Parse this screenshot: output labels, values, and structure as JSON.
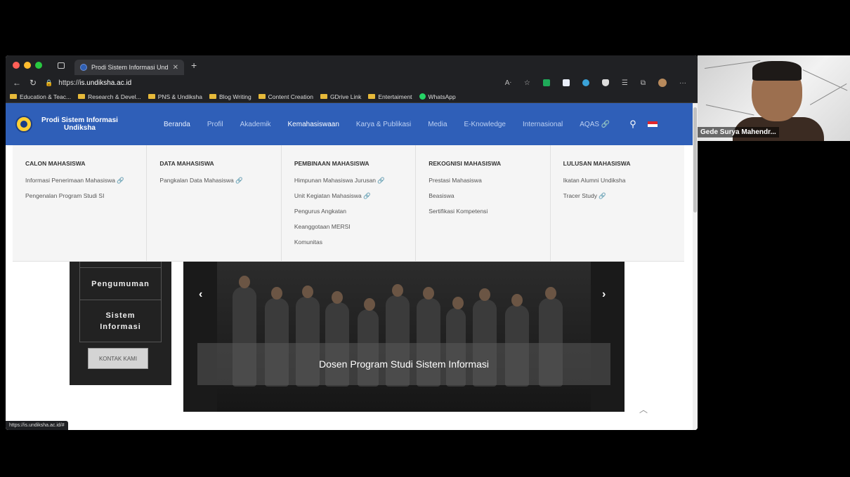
{
  "browser": {
    "tab_title": "Prodi Sistem Informasi Undiksha",
    "url_prefix": "https://",
    "url_domain": "is.undiksha.ac.id",
    "bookmarks": [
      "Education & Teac...",
      "Research & Devel...",
      "PNS & Undiksha",
      "Blog Writing",
      "Content Creation",
      "GDrive Link",
      "Entertaiment",
      "WhatsApp"
    ],
    "status_url": "https://is.undiksha.ac.id/#"
  },
  "site": {
    "brand": "Prodi Sistem Informasi Undiksha",
    "menu": [
      "Beranda",
      "Profil",
      "Akademik",
      "Kemahasiswaan",
      "Karya & Publikasi",
      "Media",
      "E-Knowledge",
      "Internasional",
      "AQAS 🔗"
    ],
    "active_menu": "Kemahasiswaan",
    "mega": [
      {
        "title": "CALON MAHASISWA",
        "links": [
          "Informasi Penerimaan Mahasiswa 🔗",
          "Pengenalan Program Studi SI"
        ]
      },
      {
        "title": "DATA MAHASISWA",
        "links": [
          "Pangkalan Data Mahasiswa 🔗"
        ]
      },
      {
        "title": "PEMBINAAN MAHASISWA",
        "links": [
          "Himpunan Mahasiswa Jurusan 🔗",
          "Unit Kegiatan Mahasiswa 🔗",
          "Pengurus Angkatan",
          "Keanggotaan MERSI",
          "Komunitas"
        ]
      },
      {
        "title": "REKOGNISI MAHASISWA",
        "links": [
          "Prestasi Mahasiswa",
          "Beasiswa",
          "Sertifikasi Kompetensi"
        ]
      },
      {
        "title": "LULUSAN MAHASISWA",
        "links": [
          "Ikatan Alumni Undiksha",
          "Tracer Study 🔗"
        ]
      }
    ],
    "sidebar": {
      "item1": "Pengumuman",
      "item2_line1": "Sistem",
      "item2_line2": "Informasi",
      "contact": "KONTAK KAMI"
    },
    "slider_caption": "Dosen Program Studi Sistem Informasi"
  },
  "video": {
    "participant": "Gede Surya Mahendr..."
  },
  "colors": {
    "nav_blue": "#2f5fb8",
    "chrome_dark": "#202124"
  }
}
